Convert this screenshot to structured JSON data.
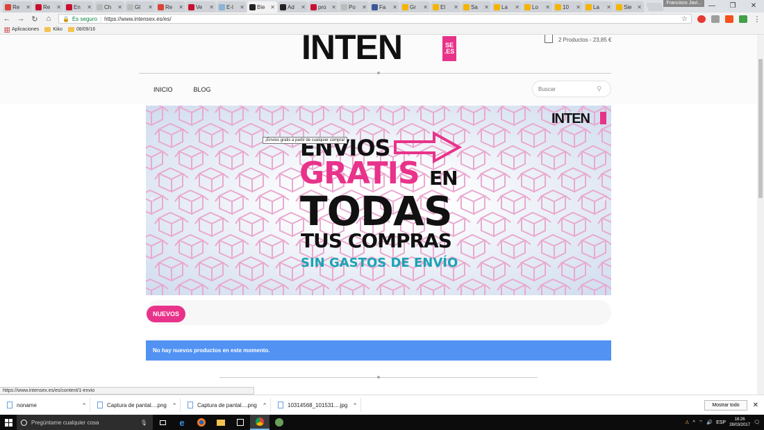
{
  "browser": {
    "tabs": [
      {
        "label": "Re",
        "color": "#db4437",
        "active": false
      },
      {
        "label": "Re",
        "color": "#c8102e",
        "active": false
      },
      {
        "label": "En",
        "color": "#c8102e",
        "active": false
      },
      {
        "label": "Ch",
        "color": "#bbbbbb",
        "active": false
      },
      {
        "label": "Gl",
        "color": "#bbbbbb",
        "active": false
      },
      {
        "label": "Re",
        "color": "#db4437",
        "active": false
      },
      {
        "label": "Ve",
        "color": "#c8102e",
        "active": false
      },
      {
        "label": "E-l",
        "color": "#8ab4d8",
        "active": false
      },
      {
        "label": "Bie",
        "color": "#222222",
        "active": true
      },
      {
        "label": "Ad",
        "color": "#222222",
        "active": false
      },
      {
        "label": "pro",
        "color": "#c8102e",
        "active": false
      },
      {
        "label": "Po",
        "color": "#bbbbbb",
        "active": false
      },
      {
        "label": "Fa",
        "color": "#3b5998",
        "active": false
      },
      {
        "label": "Gr",
        "color": "#f4b400",
        "active": false
      },
      {
        "label": "El",
        "color": "#f4b400",
        "active": false
      },
      {
        "label": "Sa",
        "color": "#f4b400",
        "active": false
      },
      {
        "label": "La",
        "color": "#f4b400",
        "active": false
      },
      {
        "label": "Lo",
        "color": "#f4b400",
        "active": false
      },
      {
        "label": "10",
        "color": "#f4b400",
        "active": false
      },
      {
        "label": "La",
        "color": "#f4b400",
        "active": false
      },
      {
        "label": "Sie",
        "color": "#f4b400",
        "active": false
      }
    ],
    "tab_close": "✕",
    "profile_name": "Francisco Javi...",
    "secure_label": "Es seguro",
    "url": "https://www.intensex.es/es/",
    "bookmarks": [
      {
        "label": "Aplicaciones",
        "type": "apps"
      },
      {
        "label": "Kiko",
        "type": "folder"
      },
      {
        "label": "08/09/16",
        "type": "folder"
      }
    ],
    "status_url": "https://www.intensex.es/es/content/1-envio"
  },
  "header": {
    "logo_text": "INTEN",
    "logo_se": "SE",
    "logo_es": ".ES",
    "cart_summary": "2 Productos - 23,85 €",
    "menu": [
      "INICIO",
      "BLOG"
    ],
    "search_placeholder": "Buscar"
  },
  "banner": {
    "logo_text": "INTEN",
    "tooltip": "¡Envios gratis a partir de cualquier compra!",
    "line1": "ENVIOS",
    "line2": "GRATIS",
    "line2b": "EN",
    "line3": "TODAS",
    "line4": "TUS COMPRAS",
    "line5": "SIN GASTOS DE ENVÍO",
    "prev_icon": "‹",
    "next_icon": "›",
    "colors": {
      "pink": "#e8338a",
      "teal": "#1aa3b4",
      "pattern": "#e9a9cf"
    }
  },
  "nuevos": {
    "badge": "NUEVOS",
    "empty_message": "No hay nuevos productos en este momento."
  },
  "downloads": {
    "items": [
      {
        "name": "noname"
      },
      {
        "name": "Captura de pantal....png"
      },
      {
        "name": "Captura de pantal....png"
      },
      {
        "name": "10314568_101531....jpg"
      }
    ],
    "show_all": "Mostrar todo"
  },
  "taskbar": {
    "search_placeholder": "Pregúntame cualquier cosa",
    "language": "ESP",
    "time": "18:26",
    "date": "28/03/2017"
  }
}
